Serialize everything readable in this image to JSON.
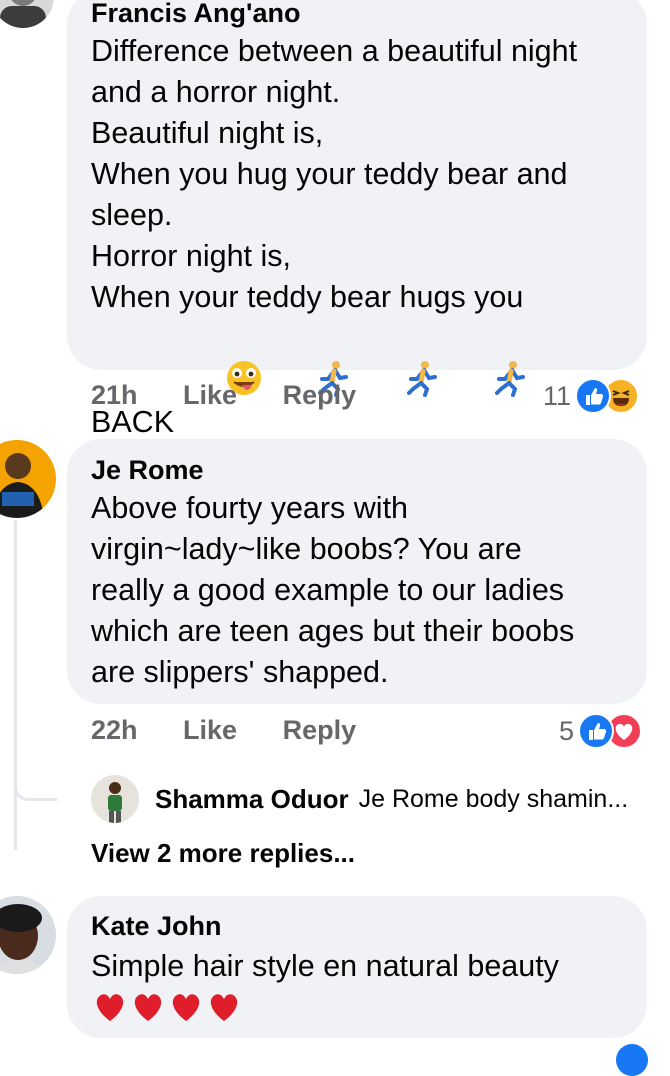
{
  "comments": [
    {
      "author": "Francis Ang'ano",
      "text": "Difference between a beautiful night\nand a horror night.\nBeautiful night is,\nWhen you hug your teddy bear and\nsleep.\nHorror night is,\nWhen your teddy bear hugs you\nBACK",
      "emojis": [
        "tongue-wink-emoji",
        "running-man-emoji",
        "running-man-emoji",
        "running-man-emoji"
      ],
      "time": "21h",
      "like_label": "Like",
      "reply_label": "Reply",
      "reaction_count": "11",
      "reaction_icons": [
        "like-reaction-icon",
        "haha-reaction-icon"
      ]
    },
    {
      "author": "Je Rome",
      "text": "Above fourty years with\nvirgin~lady~like boobs? You are\nreally a good example to our ladies\nwhich are teen ages but their boobs\nare slippers' shapped.",
      "time": "22h",
      "like_label": "Like",
      "reply_label": "Reply",
      "reaction_count": "5",
      "reaction_icons": [
        "like-reaction-icon",
        "love-reaction-icon"
      ],
      "reply_preview": {
        "author": "Shamma Oduor",
        "text": "Je Rome body shamin..."
      },
      "view_more_label": "View 2 more replies..."
    },
    {
      "author": "Kate John",
      "text": "Simple hair style en natural beauty",
      "emojis": [
        "red-heart-emoji",
        "red-heart-emoji",
        "red-heart-emoji",
        "red-heart-emoji"
      ]
    }
  ],
  "colors": {
    "bubble": "#f0f2f5",
    "meta_text": "#65676b",
    "like_blue": "#1877f2",
    "love_red": "#f33e58",
    "haha_yellow": "#f7b125"
  }
}
